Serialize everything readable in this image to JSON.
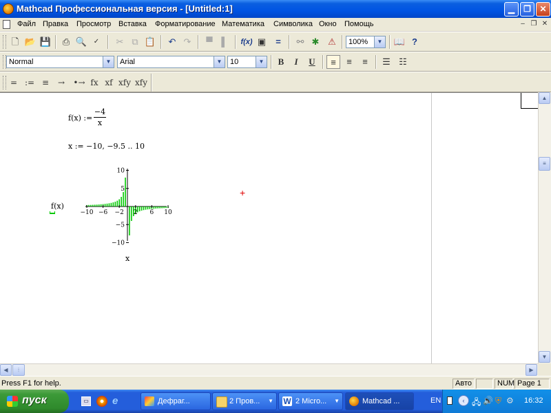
{
  "window": {
    "title": "Mathcad Профессиональная версия - [Untitled:1]",
    "min_icon": "minimize-icon",
    "max_icon": "maximize-icon",
    "close_icon": "close-icon"
  },
  "menu": {
    "items": [
      "Файл",
      "Правка",
      "Просмотр",
      "Вставка",
      "Форматирование",
      "Математика",
      "Символика",
      "Окно",
      "Помощь"
    ]
  },
  "toolbar": {
    "zoom": "100%"
  },
  "format_bar": {
    "style": "Normal",
    "font": "Arial",
    "size": "10",
    "bold": "B",
    "italic": "I",
    "underline": "U"
  },
  "math_bar": {
    "items": [
      "=",
      ":=",
      "≡",
      "→",
      "•→",
      "fx",
      "xf",
      "xfy",
      "xfy"
    ]
  },
  "worksheet": {
    "function_def": {
      "lhs": "f(x) :=",
      "numerator": "−4",
      "denominator": "x"
    },
    "range_def": "x := −10, −9.5 .. 10",
    "plot": {
      "y_label": "f(x)",
      "x_label": "x"
    }
  },
  "chart_data": {
    "type": "bar",
    "xlabel": "x",
    "ylabel": "f(x)",
    "xlim": [
      -10,
      10
    ],
    "ylim": [
      -10,
      10
    ],
    "x_ticks": [
      "−10",
      "−6",
      "−2",
      "2",
      "6",
      "10"
    ],
    "y_ticks": [
      "10",
      "5",
      "−5",
      "−10"
    ],
    "series": [
      {
        "function": "-4/x",
        "x": [
          -10,
          -9.5,
          -9,
          -8.5,
          -8,
          -7.5,
          -7,
          -6.5,
          -6,
          -5.5,
          -5,
          -4.5,
          -4,
          -3.5,
          -3,
          -2.5,
          -2,
          -1.5,
          -1,
          -0.5,
          0.5,
          1,
          1.5,
          2,
          2.5,
          3,
          3.5,
          4,
          4.5,
          5,
          5.5,
          6,
          6.5,
          7,
          7.5,
          8,
          8.5,
          9,
          9.5,
          10
        ],
        "values": [
          0.4,
          0.42,
          0.44,
          0.47,
          0.5,
          0.53,
          0.57,
          0.62,
          0.67,
          0.73,
          0.8,
          0.89,
          1,
          1.14,
          1.33,
          1.6,
          2,
          2.67,
          4,
          8,
          -8,
          -4,
          -2.67,
          -2,
          -1.6,
          -1.33,
          -1.14,
          -1,
          -0.89,
          -0.8,
          -0.73,
          -0.67,
          -0.62,
          -0.57,
          -0.53,
          -0.5,
          -0.47,
          -0.44,
          -0.42,
          -0.4
        ],
        "color": "#00c800"
      }
    ],
    "grid": false
  },
  "status": {
    "help": "Press F1 for help.",
    "mode": "Авто",
    "num": "NUM",
    "page": "Page 1"
  },
  "taskbar": {
    "start": "пуск",
    "tasks": [
      "Дефраг...",
      "2 Пров...",
      "2 Micro...",
      "Mathcad ..."
    ],
    "lang": "EN",
    "clock": "16:32"
  }
}
